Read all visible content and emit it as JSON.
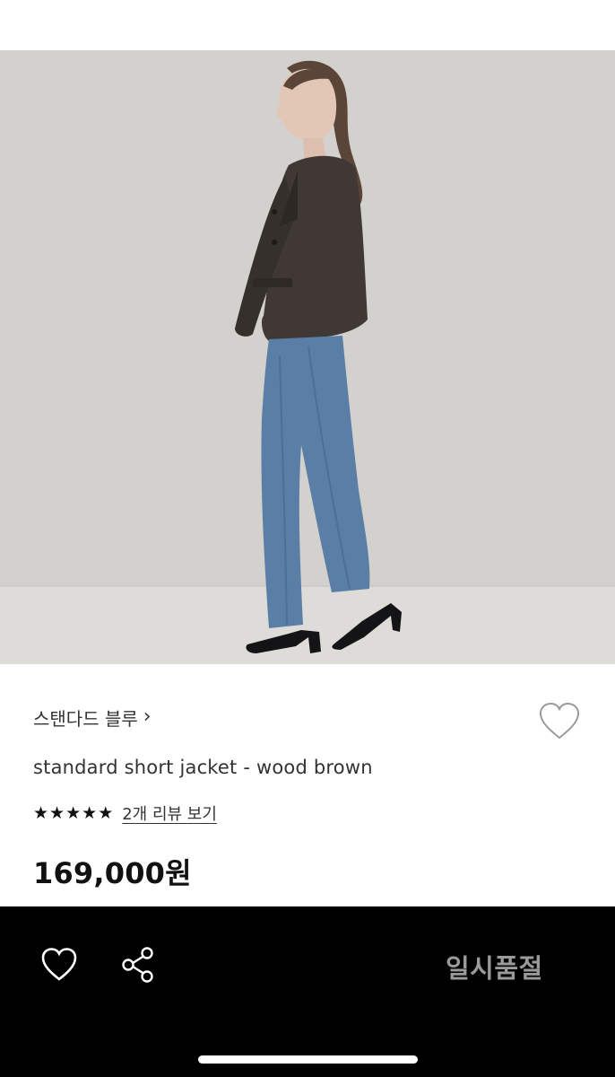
{
  "product": {
    "brand": "스탠다드 블루",
    "brand_chevron": "›",
    "name": "standard short jacket - wood brown",
    "rating_stars": "★★★★★",
    "rating_value": 5,
    "review_link": "2개 리뷰 보기",
    "price": "169,000원"
  },
  "image": {
    "subject": "model wearing brown short jacket and blue jeans"
  },
  "bottom_bar": {
    "status_label": "일시품절"
  },
  "icons": {
    "wishlist": "heart-outline-icon",
    "share": "share-icon"
  },
  "colors": {
    "bottom_bar_bg": "#000000",
    "sold_out_text": "#9a9a9a",
    "text_primary": "#111111"
  }
}
